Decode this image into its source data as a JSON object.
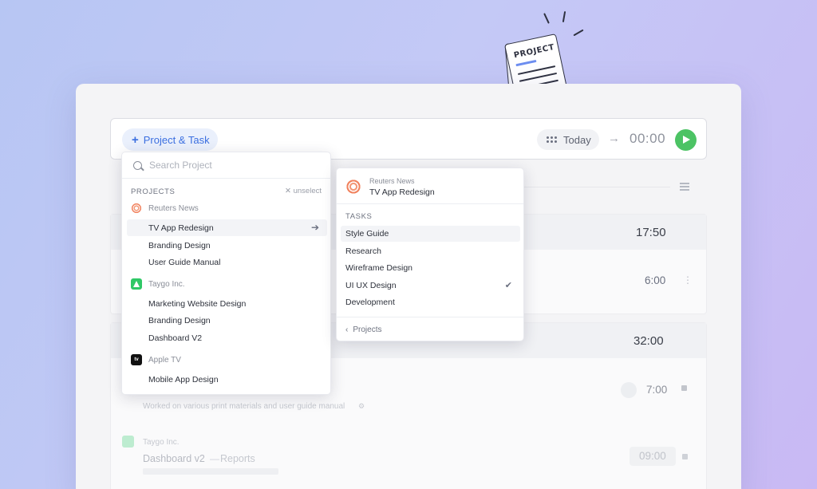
{
  "illustration": {
    "paper_title": "PROJECT"
  },
  "topbar": {
    "project_button": "Project & Task",
    "today_button": "Today",
    "timer": "00:00"
  },
  "background": {
    "group1_total": "17:50",
    "entry1_time": "6:00",
    "group2_total": "32:00",
    "entry2_time": "7:00",
    "entry2_desc": "Worked on various print materials and user guide manual",
    "entry3_client": "Taygo Inc.",
    "entry3_project": "Dashboard v2",
    "entry3_task": "Reports",
    "entry3_time": "09:00"
  },
  "project_dropdown": {
    "search_placeholder": "Search Project",
    "section_label": "PROJECTS",
    "unselect_label": "unselect",
    "clients": [
      {
        "name": "Reuters News",
        "icon": "reuters-logo-icon",
        "projects": [
          "TV App Redesign",
          "Branding Design",
          "User Guide Manual"
        ]
      },
      {
        "name": "Taygo Inc.",
        "icon": "taygo-logo-icon",
        "projects": [
          "Marketing Website Design",
          "Branding Design",
          "Dashboard V2"
        ]
      },
      {
        "name": "Apple TV",
        "icon": "apple-tv-logo-icon",
        "projects": [
          "Mobile App Design"
        ]
      }
    ],
    "apple_icon_text": "tv"
  },
  "task_dropdown": {
    "client": "Reuters News",
    "project": "TV App Redesign",
    "section_label": "TASKS",
    "tasks": [
      "Style Guide",
      "Research",
      "Wireframe Design",
      "UI UX Design",
      "Development"
    ],
    "back_label": "Projects"
  },
  "colors": {
    "accent": "#3b6fe0",
    "play": "#4cc364",
    "taygo": "#2fc866",
    "reuters": "#f1825e"
  }
}
